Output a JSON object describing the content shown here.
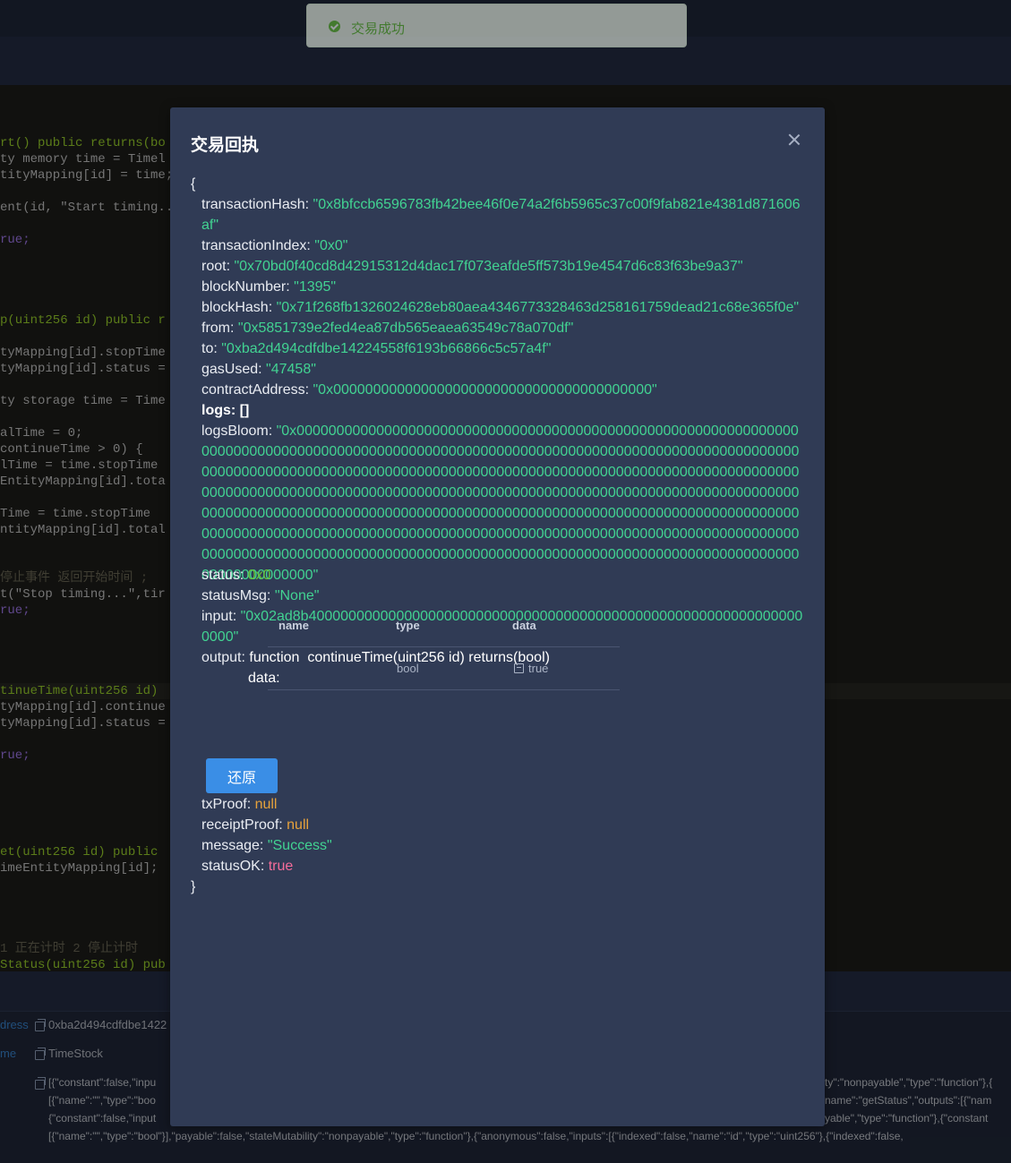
{
  "toast": {
    "text": "交易成功"
  },
  "modal": {
    "title": "交易回执",
    "receipt": {
      "open_brace": "{",
      "close_brace": "}",
      "transactionHash": {
        "key": "transactionHash",
        "value": "\"0x8bfccb6596783fb42bee46f0e74a2f6b5965c37c00f9fab821e4381d871606af\""
      },
      "transactionIndex": {
        "key": "transactionIndex",
        "value": "\"0x0\""
      },
      "root": {
        "key": "root",
        "value": "\"0x70bd0f40cd8d42915312d4dac17f073eafde5ff573b19e4547d6c83f63be9a37\""
      },
      "blockNumber": {
        "key": "blockNumber",
        "value": "\"1395\""
      },
      "blockHash": {
        "key": "blockHash",
        "value": "\"0x71f268fb1326024628eb80aea4346773328463d258161759dead21c68e365f0e\""
      },
      "from": {
        "key": "from",
        "value": "\"0x5851739e2fed4ea87db565eaea63549c78a070df\""
      },
      "to": {
        "key": "to",
        "value": "\"0xba2d494cdfdbe14224558f6193b66866c5c57a4f\""
      },
      "gasUsed": {
        "key": "gasUsed",
        "value": "\"47458\""
      },
      "contractAddress": {
        "key": "contractAddress",
        "value": "\"0x0000000000000000000000000000000000000000\""
      },
      "logs": {
        "key": "logs",
        "value": "[]"
      },
      "logsBloom": {
        "key": "logsBloom",
        "value": "\"0x00000000000000000000000000000000000000000000000000000000000000000000000000000000000000000000000000000000000000000000000000000000000000000000000000000000000000000000000000000000000000000000000000000000000000000000000000000000000000000000000000000000000000000000000000000000000000000000000000000000000000000000000000000000000000000000000000000000000000000000000000000000000000000000000000000000000000000000000000000000000000000000000000000000000000000000000000000000000000000000000000000000000000000000000000000000000000000000000\""
      },
      "status": {
        "key": "status",
        "value": "0x0"
      },
      "statusMsg": {
        "key": "statusMsg",
        "value": "\"None\""
      },
      "input": {
        "key": "input",
        "value": "\"0x02ad8b400000000000000000000000000000000000000000000000000000000000000000\""
      },
      "output": {
        "key": "output",
        "prefix": "function",
        "signature": "continueTime(uint256 id) returns(bool)",
        "data_label": "data:"
      },
      "output_table": {
        "headers": [
          "name",
          "type",
          "data"
        ],
        "rows": [
          {
            "name": "",
            "type": "bool",
            "data": "true"
          }
        ]
      },
      "restore_button": "还原",
      "txProof": {
        "key": "txProof",
        "value": "null"
      },
      "receiptProof": {
        "key": "receiptProof",
        "value": "null"
      },
      "message": {
        "key": "message",
        "value": "\"Success\""
      },
      "statusOK": {
        "key": "statusOK",
        "value": "true"
      }
    }
  },
  "background_code": [
    "rt() public returns(bo",
    "ty memory time = Timel",
    "tityMapping[id] = time;",
    "ent(id, \"Start timing...",
    "rue;",
    "p(uint256 id) public r",
    "tyMapping[id].stopTime",
    "tyMapping[id].status =",
    "ty storage time = Time",
    "alTime = 0;",
    "continueTime > 0) {",
    "lTime = time.stopTime",
    "EntityMapping[id].tota",
    "Time = time.stopTime",
    "ntityMapping[id].total",
    "停止事件 返回开始时间 ;",
    "t(\"Stop timing...\",tir",
    "rue;",
    "tinueTime(uint256 id)",
    "tyMapping[id].continue",
    "tyMapping[id].status =",
    "rue;",
    "et(uint256 id) public",
    "imeEntityMapping[id];",
    "1 正在计时 2 停止计时",
    "Status(uint256 id) pub"
  ],
  "info_panel": {
    "address_key": "dress",
    "address_value": "0xba2d494cdfdbe1422",
    "name_key": "me",
    "name_value": "TimeStock",
    "abi_lines": [
      "[{\"constant\":false,\"inpu",
      "[{\"name\":\"\",\"type\":\"boo",
      "{\"constant\":false,\"input",
      "[{\"name\":\"\",\"type\":\"bool\"}],\"payable\":false,\"stateMutability\":\"nonpayable\",\"type\":\"function\"},{\"anonymous\":false,\"inputs\":[{\"indexed\":false,\"name\":\"id\",\"type\":\"uint256\"},{\"indexed\":false,"
    ],
    "abi_right_lines": [
      "ty\":\"nonpayable\",\"type\":\"function\"},{",
      "name\":\"getStatus\",\"outputs\":[{\"nam",
      "yable\",\"type\":\"function\"},{\"constant"
    ]
  }
}
